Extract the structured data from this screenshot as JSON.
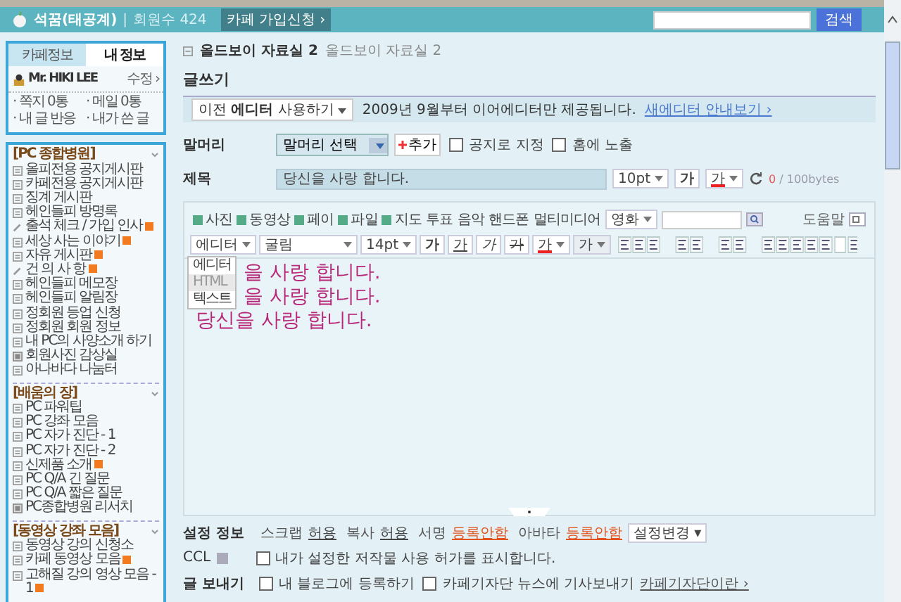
{
  "header": {
    "cafe_name": "석꿈(태공계)",
    "separator": "|",
    "member_count": "회원수 424",
    "join_button": "카페 가입신청 ›",
    "search_button": "검색"
  },
  "sidebar": {
    "tabs": [
      {
        "label": "카페정보",
        "selected": false
      },
      {
        "label": "내 정보",
        "selected": true
      }
    ],
    "profile": {
      "name": "Mr. HIKI LEE",
      "edit": "수정 ›",
      "links": [
        "· 쪽지 0통",
        "· 메일 0통",
        "· 내 글 반응",
        "· 내가 쓴 글"
      ]
    },
    "groups": [
      {
        "title": "[PC 종합병원]",
        "items": [
          {
            "label": "올피전용 공지게시판",
            "kind": "board",
            "new": false
          },
          {
            "label": "카페전용 공지게시판",
            "kind": "board",
            "new": false
          },
          {
            "label": "징계 게시판",
            "kind": "board",
            "new": false
          },
          {
            "label": "헤인들피 방명록",
            "kind": "board",
            "new": false
          },
          {
            "label": "출석 체크 / 가입 인사",
            "kind": "pencil",
            "new": true
          },
          {
            "label": "세상 사는 이야기",
            "kind": "board",
            "new": true
          },
          {
            "label": "자유 게시판",
            "kind": "board",
            "new": true
          },
          {
            "label": "건 의 사 항",
            "kind": "pencil",
            "new": true
          },
          {
            "label": "헤인들피 메모장",
            "kind": "board",
            "new": false
          },
          {
            "label": "헤인들피 알림장",
            "kind": "board",
            "new": false
          },
          {
            "label": "정회원 등업 신청",
            "kind": "board",
            "new": false
          },
          {
            "label": "정회원 회원 정보",
            "kind": "board",
            "new": false
          },
          {
            "label": "내 PC의 사양소개 하기",
            "kind": "board",
            "new": false
          },
          {
            "label": "회원사진 감상실",
            "kind": "album",
            "new": false
          },
          {
            "label": "아나바다 나눔터",
            "kind": "board",
            "new": false
          }
        ]
      },
      {
        "title": "[배움의 장]",
        "items": [
          {
            "label": "PC 파워팁",
            "kind": "board",
            "new": false
          },
          {
            "label": "PC 강좌 모음",
            "kind": "board",
            "new": false
          },
          {
            "label": "PC 자가 진단 - 1",
            "kind": "board",
            "new": false
          },
          {
            "label": "PC 자가 진단 - 2",
            "kind": "board",
            "new": false
          },
          {
            "label": "신제품 소개",
            "kind": "board",
            "new": true
          },
          {
            "label": "PC Q/A 긴 질문",
            "kind": "board",
            "new": false
          },
          {
            "label": "PC Q/A 짧은 질문",
            "kind": "board",
            "new": false
          },
          {
            "label": "PC종합병원 리서치",
            "kind": "album",
            "new": false
          }
        ]
      },
      {
        "title": "[동영상 강좌 모음]",
        "items": [
          {
            "label": "동영상 강의 신청소",
            "kind": "board",
            "new": false
          },
          {
            "label": "카페 동영상 모음",
            "kind": "board",
            "new": true
          },
          {
            "label": "고해질 강의 영상 모음 - 1",
            "kind": "board",
            "new": true
          }
        ]
      }
    ]
  },
  "breadcrumb": {
    "current": "올드보이 자료실 2",
    "parent": "올드보이 자료실 2"
  },
  "page_title": "글쓰기",
  "notice": {
    "dropdown": "이전 **에디터** 사용하기",
    "message": "2009년 9월부터 이어에디터만 제공됩니다.",
    "link": "새에디터 안내보기 ›"
  },
  "form": {
    "head_label": "말머리",
    "head_select": "말머리 선택",
    "add_button": "추가",
    "options": [
      {
        "label": "공지로 지정",
        "checked": false
      },
      {
        "label": "홈에 노출",
        "checked": false
      }
    ],
    "subject_label": "제목",
    "subject_value": "당신을 사랑 합니다.",
    "subject_size": "10pt",
    "subject_bold": "가",
    "subject_color_button": "가",
    "byte_used": "0",
    "byte_limit": "/ 100bytes"
  },
  "toolbar": {
    "insert_items": [
      "사진",
      "동영상",
      "페이",
      "파일",
      "지도",
      "투표",
      "음악",
      "핸드폰",
      "멀티미디어"
    ],
    "search_select": "영화",
    "help": "도움말"
  },
  "format_bar": {
    "mode": "에디터",
    "font": "굴림",
    "size": "14pt",
    "bold": "가",
    "underline": "가",
    "italic": "가",
    "strike": "가",
    "text_color_button": "가",
    "highlight_button": "가"
  },
  "mode_menu": [
    {
      "label": "에디터",
      "selected": false
    },
    {
      "label": "HTML",
      "selected": true
    },
    {
      "label": "텍스트",
      "selected": false
    }
  ],
  "content_lines": [
    {
      "text": "을 사랑 합니다.",
      "under_menu": true
    },
    {
      "text": "을 사랑 합니다.",
      "under_menu": true
    },
    {
      "text": "당신을 사랑 합니다.",
      "under_menu": false
    }
  ],
  "settings": {
    "label": "설정 정보",
    "items": [
      {
        "name": "스크랩",
        "value": "허용",
        "kind": "allowed"
      },
      {
        "name": "복사",
        "value": "허용",
        "kind": "allowed"
      },
      {
        "name": "서명",
        "value": "등록안함",
        "kind": "not_set"
      },
      {
        "name": "아바타",
        "value": "등록안함",
        "kind": "not_set"
      }
    ],
    "change_button": "설정변경 ▾"
  },
  "ccl": {
    "label": "CCL",
    "option": {
      "label": "내가 설정한 저작물 사용 허가를 표시합니다.",
      "checked": false
    }
  },
  "send": {
    "label": "글 보내기",
    "options": [
      {
        "label": "내 블로그에 등록하기",
        "checked": false
      },
      {
        "label": "카페기자단 뉴스에 기사보내기",
        "checked": false
      }
    ],
    "link": "카페기자단이란 ›"
  }
}
